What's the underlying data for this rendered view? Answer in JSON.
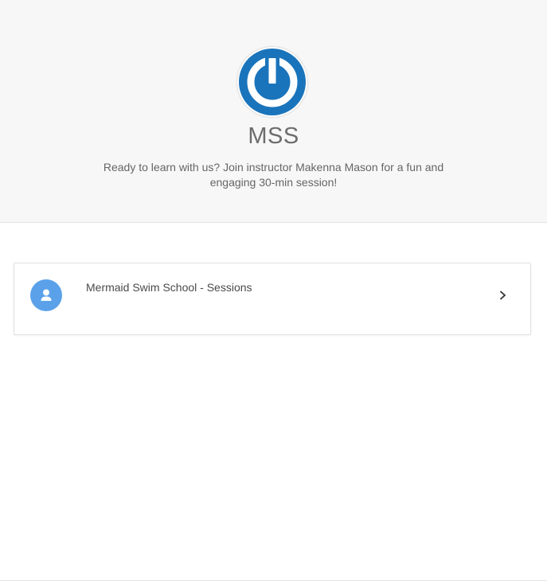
{
  "header": {
    "logo_icon": "power-icon",
    "logo_color": "#1a74bb",
    "title": "MSS",
    "description": "Ready to learn with us? Join instructor Makenna Mason for a fun and engaging 30-min session!"
  },
  "cards": [
    {
      "label": "Mermaid Swim School - Sessions",
      "icon": "user-icon",
      "icon_bg": "#5aa1ea",
      "action_icon": "chevron-right-icon"
    }
  ]
}
